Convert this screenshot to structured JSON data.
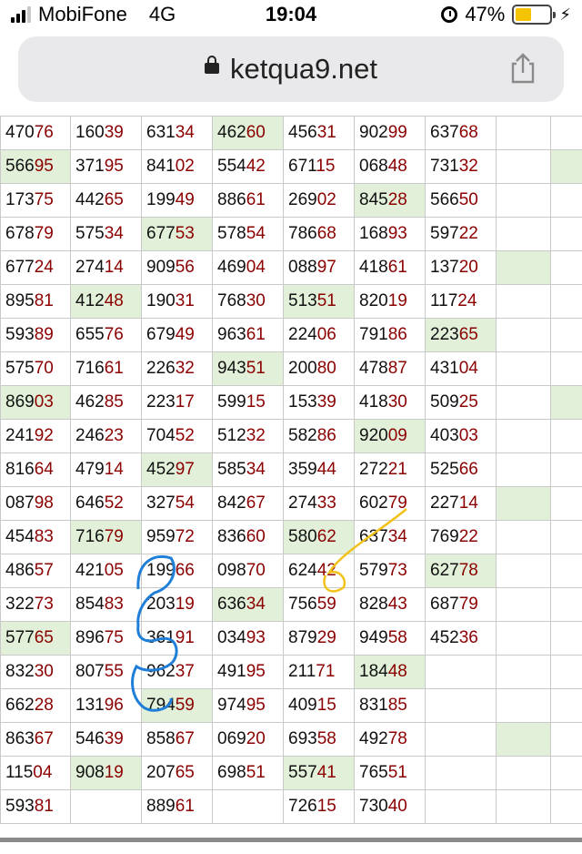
{
  "status_bar": {
    "carrier": "MobiFone",
    "network": "4G",
    "time": "19:04",
    "battery_percent": "47%",
    "battery_level": 0.47
  },
  "url_bar": {
    "url": "ketqua9.net",
    "lock_icon": "lock-icon",
    "share_icon": "share-icon"
  },
  "colors": {
    "highlight_bg": "#e2f0d9",
    "tail_digits": "#8b0000",
    "annotation_blue": "#1f7fd8",
    "annotation_yellow": "#f2c21b"
  },
  "table": {
    "rows": [
      [
        {
          "h": "470",
          "t": "76"
        },
        {
          "h": "160",
          "t": "39"
        },
        {
          "h": "631",
          "t": "34"
        },
        {
          "h": "462",
          "t": "60",
          "hl": true
        },
        {
          "h": "456",
          "t": "31"
        },
        {
          "h": "902",
          "t": "99"
        },
        {
          "h": "637",
          "t": "68"
        },
        {
          "h": "",
          "t": ""
        },
        {
          "h": "",
          "t": ""
        }
      ],
      [
        {
          "h": "566",
          "t": "95",
          "hl": true
        },
        {
          "h": "371",
          "t": "95"
        },
        {
          "h": "841",
          "t": "02"
        },
        {
          "h": "554",
          "t": "42"
        },
        {
          "h": "671",
          "t": "15"
        },
        {
          "h": "068",
          "t": "48"
        },
        {
          "h": "731",
          "t": "32"
        },
        {
          "h": "",
          "t": ""
        },
        {
          "h": "",
          "t": "",
          "hl": true
        }
      ],
      [
        {
          "h": "173",
          "t": "75"
        },
        {
          "h": "442",
          "t": "65"
        },
        {
          "h": "199",
          "t": "49"
        },
        {
          "h": "886",
          "t": "61"
        },
        {
          "h": "269",
          "t": "02"
        },
        {
          "h": "845",
          "t": "28",
          "hl": true
        },
        {
          "h": "566",
          "t": "50"
        },
        {
          "h": "",
          "t": ""
        },
        {
          "h": "",
          "t": ""
        }
      ],
      [
        {
          "h": "678",
          "t": "79"
        },
        {
          "h": "575",
          "t": "34"
        },
        {
          "h": "677",
          "t": "53",
          "hl": true
        },
        {
          "h": "578",
          "t": "54"
        },
        {
          "h": "786",
          "t": "68"
        },
        {
          "h": "168",
          "t": "93"
        },
        {
          "h": "597",
          "t": "22"
        },
        {
          "h": "",
          "t": ""
        },
        {
          "h": "",
          "t": ""
        }
      ],
      [
        {
          "h": "677",
          "t": "24"
        },
        {
          "h": "274",
          "t": "14"
        },
        {
          "h": "909",
          "t": "56"
        },
        {
          "h": "469",
          "t": "04"
        },
        {
          "h": "088",
          "t": "97"
        },
        {
          "h": "418",
          "t": "61"
        },
        {
          "h": "137",
          "t": "20"
        },
        {
          "h": "",
          "t": "",
          "hl": true
        },
        {
          "h": "",
          "t": ""
        }
      ],
      [
        {
          "h": "895",
          "t": "81"
        },
        {
          "h": "412",
          "t": "48",
          "hl": true
        },
        {
          "h": "190",
          "t": "31"
        },
        {
          "h": "768",
          "t": "30"
        },
        {
          "h": "513",
          "t": "51",
          "hl": true
        },
        {
          "h": "820",
          "t": "19"
        },
        {
          "h": "117",
          "t": "24"
        },
        {
          "h": "",
          "t": ""
        },
        {
          "h": "",
          "t": ""
        }
      ],
      [
        {
          "h": "593",
          "t": "89"
        },
        {
          "h": "655",
          "t": "76"
        },
        {
          "h": "679",
          "t": "49"
        },
        {
          "h": "963",
          "t": "61"
        },
        {
          "h": "224",
          "t": "06"
        },
        {
          "h": "791",
          "t": "86"
        },
        {
          "h": "223",
          "t": "65",
          "hl": true
        },
        {
          "h": "",
          "t": ""
        },
        {
          "h": "",
          "t": ""
        }
      ],
      [
        {
          "h": "575",
          "t": "70"
        },
        {
          "h": "716",
          "t": "61"
        },
        {
          "h": "226",
          "t": "32"
        },
        {
          "h": "943",
          "t": "51",
          "hl": true
        },
        {
          "h": "200",
          "t": "80"
        },
        {
          "h": "478",
          "t": "87"
        },
        {
          "h": "431",
          "t": "04"
        },
        {
          "h": "",
          "t": ""
        },
        {
          "h": "",
          "t": ""
        }
      ],
      [
        {
          "h": "869",
          "t": "03",
          "hl": true
        },
        {
          "h": "462",
          "t": "85"
        },
        {
          "h": "223",
          "t": "17"
        },
        {
          "h": "599",
          "t": "15"
        },
        {
          "h": "153",
          "t": "39"
        },
        {
          "h": "418",
          "t": "30"
        },
        {
          "h": "509",
          "t": "25"
        },
        {
          "h": "",
          "t": ""
        },
        {
          "h": "",
          "t": "",
          "hl": true
        }
      ],
      [
        {
          "h": "241",
          "t": "92"
        },
        {
          "h": "246",
          "t": "23"
        },
        {
          "h": "704",
          "t": "52"
        },
        {
          "h": "512",
          "t": "32"
        },
        {
          "h": "582",
          "t": "86"
        },
        {
          "h": "920",
          "t": "09",
          "hl": true
        },
        {
          "h": "403",
          "t": "03"
        },
        {
          "h": "",
          "t": ""
        },
        {
          "h": "",
          "t": ""
        }
      ],
      [
        {
          "h": "816",
          "t": "64"
        },
        {
          "h": "479",
          "t": "14"
        },
        {
          "h": "452",
          "t": "97",
          "hl": true
        },
        {
          "h": "585",
          "t": "34"
        },
        {
          "h": "359",
          "t": "44"
        },
        {
          "h": "272",
          "t": "21"
        },
        {
          "h": "525",
          "t": "66"
        },
        {
          "h": "",
          "t": ""
        },
        {
          "h": "",
          "t": ""
        }
      ],
      [
        {
          "h": "087",
          "t": "98"
        },
        {
          "h": "646",
          "t": "52"
        },
        {
          "h": "327",
          "t": "54"
        },
        {
          "h": "842",
          "t": "67"
        },
        {
          "h": "274",
          "t": "33"
        },
        {
          "h": "602",
          "t": "79"
        },
        {
          "h": "227",
          "t": "14"
        },
        {
          "h": "",
          "t": "",
          "hl": true
        },
        {
          "h": "",
          "t": ""
        }
      ],
      [
        {
          "h": "454",
          "t": "83"
        },
        {
          "h": "716",
          "t": "79",
          "hl": true
        },
        {
          "h": "959",
          "t": "72"
        },
        {
          "h": "836",
          "t": "60"
        },
        {
          "h": "580",
          "t": "62",
          "hl": true
        },
        {
          "h": "637",
          "t": "34"
        },
        {
          "h": "769",
          "t": "22"
        },
        {
          "h": "",
          "t": ""
        },
        {
          "h": "",
          "t": ""
        }
      ],
      [
        {
          "h": "486",
          "t": "57"
        },
        {
          "h": "421",
          "t": "05"
        },
        {
          "h": "199",
          "t": "66"
        },
        {
          "h": "098",
          "t": "70"
        },
        {
          "h": "624",
          "t": "42"
        },
        {
          "h": "579",
          "t": "73"
        },
        {
          "h": "627",
          "t": "78",
          "hl": true
        },
        {
          "h": "",
          "t": ""
        },
        {
          "h": "",
          "t": ""
        }
      ],
      [
        {
          "h": "322",
          "t": "73"
        },
        {
          "h": "854",
          "t": "83"
        },
        {
          "h": "203",
          "t": "19"
        },
        {
          "h": "636",
          "t": "34",
          "hl": true
        },
        {
          "h": "756",
          "t": "59"
        },
        {
          "h": "828",
          "t": "43"
        },
        {
          "h": "687",
          "t": "79"
        },
        {
          "h": "",
          "t": ""
        },
        {
          "h": "",
          "t": ""
        }
      ],
      [
        {
          "h": "577",
          "t": "65",
          "hl": true
        },
        {
          "h": "896",
          "t": "75"
        },
        {
          "h": "361",
          "t": "91"
        },
        {
          "h": "034",
          "t": "93"
        },
        {
          "h": "879",
          "t": "29"
        },
        {
          "h": "949",
          "t": "58"
        },
        {
          "h": "452",
          "t": "36"
        },
        {
          "h": "",
          "t": ""
        },
        {
          "h": "",
          "t": ""
        }
      ],
      [
        {
          "h": "832",
          "t": "30"
        },
        {
          "h": "807",
          "t": "55"
        },
        {
          "h": "962",
          "t": "37"
        },
        {
          "h": "491",
          "t": "95"
        },
        {
          "h": "211",
          "t": "71"
        },
        {
          "h": "184",
          "t": "48",
          "hl": true
        },
        {
          "h": "",
          "t": ""
        },
        {
          "h": "",
          "t": ""
        },
        {
          "h": "",
          "t": ""
        }
      ],
      [
        {
          "h": "662",
          "t": "28"
        },
        {
          "h": "131",
          "t": "96"
        },
        {
          "h": "794",
          "t": "59",
          "hl": true
        },
        {
          "h": "974",
          "t": "95"
        },
        {
          "h": "409",
          "t": "15"
        },
        {
          "h": "831",
          "t": "85"
        },
        {
          "h": "",
          "t": ""
        },
        {
          "h": "",
          "t": ""
        },
        {
          "h": "",
          "t": ""
        }
      ],
      [
        {
          "h": "863",
          "t": "67"
        },
        {
          "h": "546",
          "t": "39"
        },
        {
          "h": "858",
          "t": "67"
        },
        {
          "h": "069",
          "t": "20"
        },
        {
          "h": "693",
          "t": "58"
        },
        {
          "h": "492",
          "t": "78"
        },
        {
          "h": "",
          "t": ""
        },
        {
          "h": "",
          "t": "",
          "hl": true
        },
        {
          "h": "",
          "t": ""
        }
      ],
      [
        {
          "h": "115",
          "t": "04"
        },
        {
          "h": "908",
          "t": "19",
          "hl": true
        },
        {
          "h": "207",
          "t": "65"
        },
        {
          "h": "698",
          "t": "51"
        },
        {
          "h": "557",
          "t": "41",
          "hl": true
        },
        {
          "h": "765",
          "t": "51"
        },
        {
          "h": "",
          "t": ""
        },
        {
          "h": "",
          "t": ""
        },
        {
          "h": "",
          "t": ""
        }
      ],
      [
        {
          "h": "593",
          "t": "81"
        },
        {
          "h": "",
          "t": ""
        },
        {
          "h": "889",
          "t": "61"
        },
        {
          "h": "",
          "t": ""
        },
        {
          "h": "726",
          "t": "15"
        },
        {
          "h": "730",
          "t": "40"
        },
        {
          "h": "",
          "t": ""
        },
        {
          "h": "",
          "t": ""
        },
        {
          "h": "",
          "t": ""
        }
      ]
    ]
  }
}
